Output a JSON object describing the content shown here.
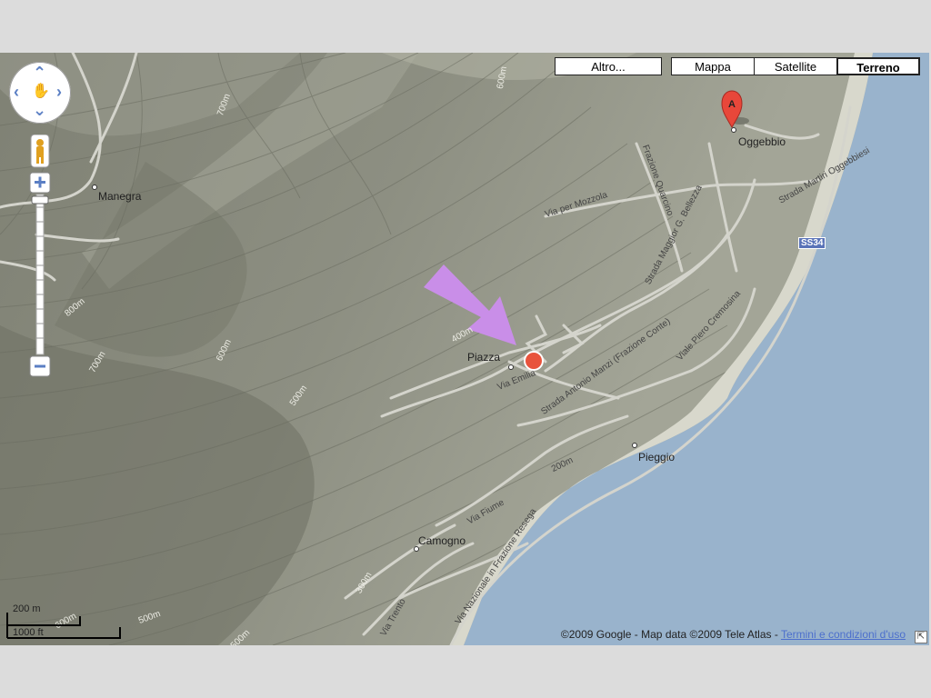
{
  "map_types": {
    "more": "Altro...",
    "map": "Mappa",
    "satellite": "Satellite",
    "terrain": "Terreno",
    "selected": "Terreno"
  },
  "places": {
    "manegra": "Manegra",
    "oggebbio": "Oggebbio",
    "piazza": "Piazza",
    "pieggio": "Pieggio",
    "camogno": "Camogno"
  },
  "roads": {
    "mozzola": "Via per Mozzola",
    "quarcino": "Frazione Quarcino",
    "g_bellezza": "Strada Maggior G. Bellezza",
    "martiri": "Strada Martiri Oggebbiesi",
    "manzi": "Strada Antonio Manzi (Frazione Conte)",
    "emilia": "Via Emilia",
    "cremosina": "Viale Piero Cremosina",
    "fiume": "Via Fiume",
    "nazionale": "Via Nazionale in Frazione Resega",
    "trento": "Via Trento"
  },
  "highway_shield": "SS34",
  "marker_label": "A",
  "elevations": [
    "700m",
    "600m",
    "800m",
    "700m",
    "600m",
    "500m",
    "400m",
    "600m",
    "500m",
    "300m",
    "200m",
    "500m",
    "300m"
  ],
  "scale": {
    "metric": "200 m",
    "imperial": "1000 ft"
  },
  "copyright": {
    "text": "©2009 Google - Map data ©2009 Tele Atlas - ",
    "link": "Termini e condizioni d'uso"
  },
  "colors": {
    "water": "#99b3cc",
    "terrain_dark": "#7d7f72",
    "terrain_light": "#b9bbad",
    "arrow": "#c98ee8",
    "marker": "#e8533c"
  },
  "icons": [
    "pan-control-icon",
    "pegman-icon",
    "zoom-in-icon",
    "zoom-out-icon",
    "marker-a-icon",
    "location-dot-icon",
    "pointer-arrow-icon",
    "resize-icon"
  ]
}
